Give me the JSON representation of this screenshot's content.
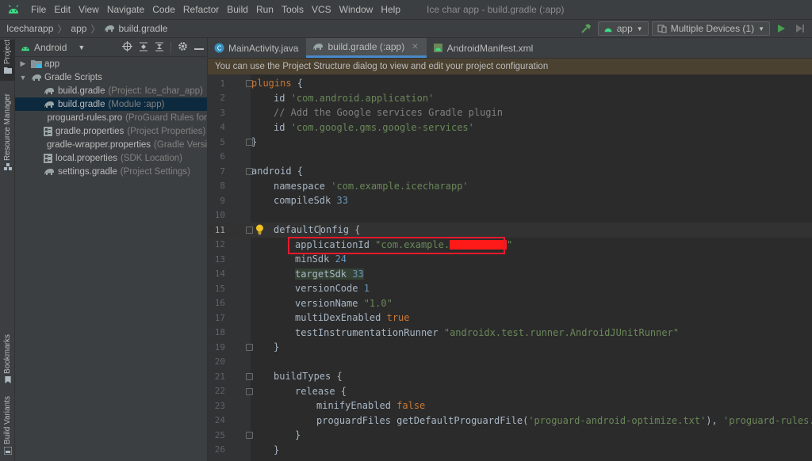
{
  "menubar": {
    "items": [
      "File",
      "Edit",
      "View",
      "Navigate",
      "Code",
      "Refactor",
      "Build",
      "Run",
      "Tools",
      "VCS",
      "Window",
      "Help"
    ],
    "window_title": "Ice char app - build.gradle (:app)"
  },
  "navbar": {
    "breadcrumbs": [
      "Icecharapp",
      "app",
      "build.gradle"
    ],
    "config": "app",
    "device": "Multiple Devices (1)"
  },
  "left_strip": {
    "project": "Project",
    "resource_manager": "Resource Manager",
    "bookmarks": "Bookmarks",
    "build_variants": "Build Variants"
  },
  "project_panel": {
    "view": "Android",
    "tree": [
      {
        "label": "app",
        "hint": ""
      },
      {
        "label": "Gradle Scripts",
        "hint": ""
      },
      {
        "label": "build.gradle",
        "hint": "(Project: Ice_char_app)"
      },
      {
        "label": "build.gradle",
        "hint": "(Module :app)"
      },
      {
        "label": "proguard-rules.pro",
        "hint": "(ProGuard Rules for"
      },
      {
        "label": "gradle.properties",
        "hint": "(Project Properties)"
      },
      {
        "label": "gradle-wrapper.properties",
        "hint": "(Gradle Versi"
      },
      {
        "label": "local.properties",
        "hint": "(SDK Location)"
      },
      {
        "label": "settings.gradle",
        "hint": "(Project Settings)"
      }
    ]
  },
  "editor_tabs": [
    {
      "label": "MainActivity.java"
    },
    {
      "label": "build.gradle (:app)"
    },
    {
      "label": "AndroidManifest.xml"
    }
  ],
  "banner": "You can use the Project Structure dialog to view and edit your project configuration",
  "code": {
    "l1_kw": "plugins",
    "l1_rest": " {",
    "l2_a": "id ",
    "l2_s": "'com.android.application'",
    "l3": "// Add the Google services Gradle plugin",
    "l4_a": "id ",
    "l4_s": "'com.google.gms.google-services'",
    "l5": "}",
    "l7_a": "android",
    "l7_b": " {",
    "l8_a": "namespace ",
    "l8_s": "'com.example.icecharapp'",
    "l9_a": "compileSdk ",
    "l9_n": "33",
    "l11_a": "defaultC",
    "l11_b": "onfig {",
    "l12_a": "applicationId ",
    "l12_s": "\"com.example.",
    "l12_tail": "\"",
    "l13_a": "minSdk ",
    "l13_n": "24",
    "l14_a": "targetSdk ",
    "l14_n": "33",
    "l15_a": "versionCode ",
    "l15_n": "1",
    "l16_a": "versionName ",
    "l16_s": "\"1.0\"",
    "l17_a": "multiDexEnabled ",
    "l17_k": "true",
    "l18_a": "testInstrumentationRunner ",
    "l18_s": "\"androidx.test.runner.AndroidJUnitRunner\"",
    "l19": "}",
    "l21_a": "buildTypes {",
    "l22_a": "release {",
    "l23_a": "minifyEnabled ",
    "l23_k": "false",
    "l24_a": "proguardFiles getDefaultProguardFile(",
    "l24_s1": "'proguard-android-optimize.txt'",
    "l24_b": "), ",
    "l24_s2": "'proguard-rules.pro'",
    "l25": "}",
    "l26": "}",
    "line_numbers": [
      "1",
      "2",
      "3",
      "4",
      "5",
      "6",
      "7",
      "8",
      "9",
      "10",
      "11",
      "12",
      "13",
      "14",
      "15",
      "16",
      "17",
      "18",
      "19",
      "20",
      "21",
      "22",
      "23",
      "24",
      "25",
      "26"
    ]
  },
  "colors": {
    "accent": "#4a88c7",
    "annotation_box": "#e8192c",
    "redaction": "#ff1a1a"
  }
}
